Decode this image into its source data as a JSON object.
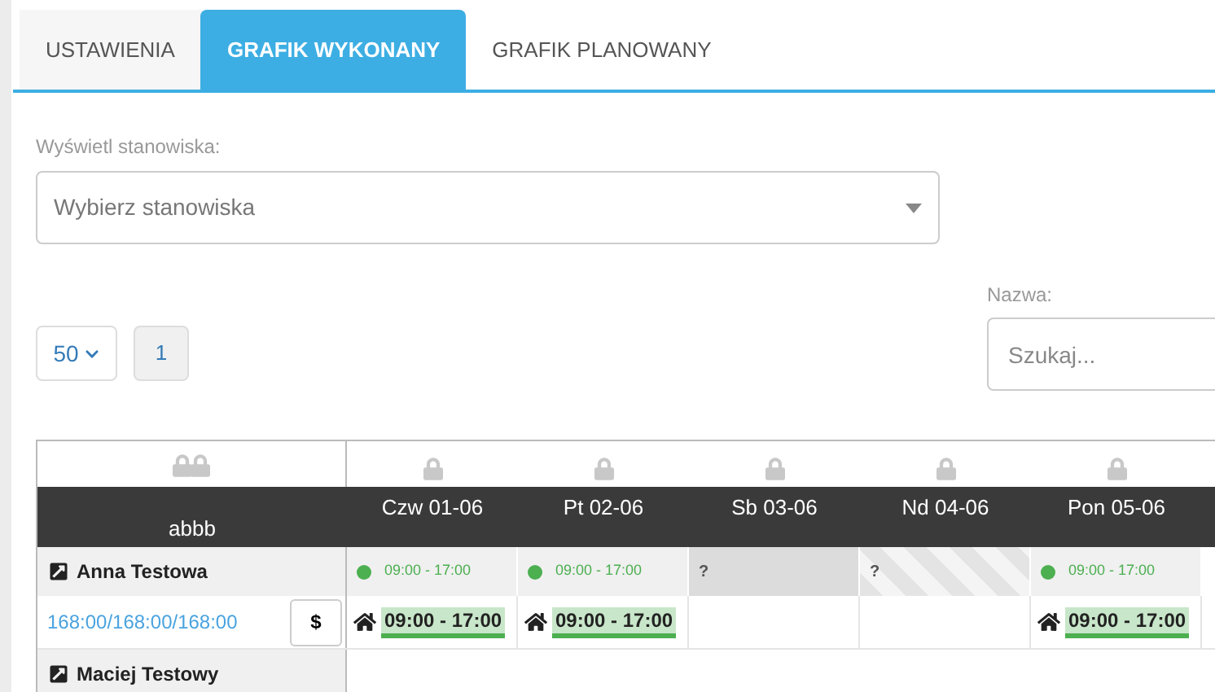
{
  "tabs": [
    {
      "label": "USTAWIENIA",
      "selected": false
    },
    {
      "label": "GRAFIK WYKONANY",
      "selected": true
    },
    {
      "label": "GRAFIK PLANOWANY",
      "selected": false
    }
  ],
  "positions_filter": {
    "label": "Wyświetl stanowiska:",
    "placeholder": "Wybierz stanowiska"
  },
  "page_size": "50",
  "pages": [
    {
      "label": "1",
      "selected": true
    }
  ],
  "search": {
    "label": "Nazwa:",
    "placeholder": "Szukaj..."
  },
  "table": {
    "corner_label": "abbb",
    "days": [
      {
        "label": "Czw 01-06",
        "locked": true
      },
      {
        "label": "Pt 02-06",
        "locked": true
      },
      {
        "label": "Sb 03-06",
        "locked": true
      },
      {
        "label": "Nd 04-06",
        "locked": true
      },
      {
        "label": "Pon 05-06",
        "locked": true
      }
    ],
    "rows": [
      {
        "name": "Anna Testowa",
        "hours": "168:00/168:00/168:00",
        "pay_button": "$",
        "cells": [
          {
            "kind": "work",
            "planned": "09:00 - 17:00",
            "actual": "09:00 - 17:00"
          },
          {
            "kind": "work",
            "planned": "09:00 - 17:00",
            "actual": "09:00 - 17:00"
          },
          {
            "kind": "free",
            "mark": "?"
          },
          {
            "kind": "holiday",
            "mark": "?"
          },
          {
            "kind": "work",
            "planned": "09:00 - 17:00",
            "actual": "09:00 - 17:00"
          }
        ]
      },
      {
        "name": "Maciej Testowy",
        "cells": []
      }
    ]
  }
}
